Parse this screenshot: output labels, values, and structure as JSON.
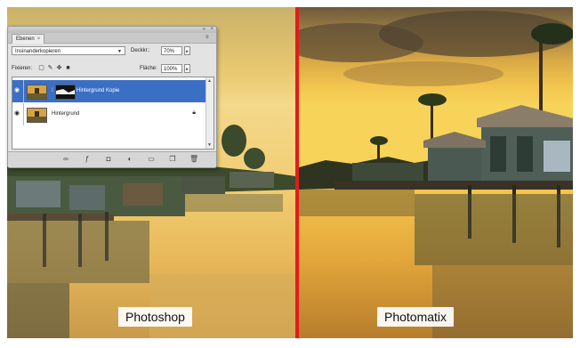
{
  "captions": {
    "left": "Photoshop",
    "right": "Photomatix"
  },
  "colors": {
    "divider": "#e11d1d",
    "selected_layer": "#3b6fc4",
    "panel_bg": "#e3e3e3"
  },
  "layers_panel": {
    "tab_label": "Ebenen",
    "tab_close": "×",
    "blend_mode": "Insinanderkopieren",
    "opacity_label": "Deckkr.:",
    "opacity_value": "70%",
    "lock_label": "Fixieren:",
    "fill_label": "Fläche:",
    "fill_value": "100%",
    "layers": [
      {
        "name": "Hintergrund Kopie",
        "selected": true,
        "has_mask": true
      },
      {
        "name": "Hintergrund",
        "selected": false,
        "locked": true
      }
    ],
    "footer_icons": [
      "link-icon",
      "fx-icon",
      "mask-icon",
      "adjustment-icon",
      "group-icon",
      "new-layer-icon",
      "trash-icon"
    ]
  }
}
